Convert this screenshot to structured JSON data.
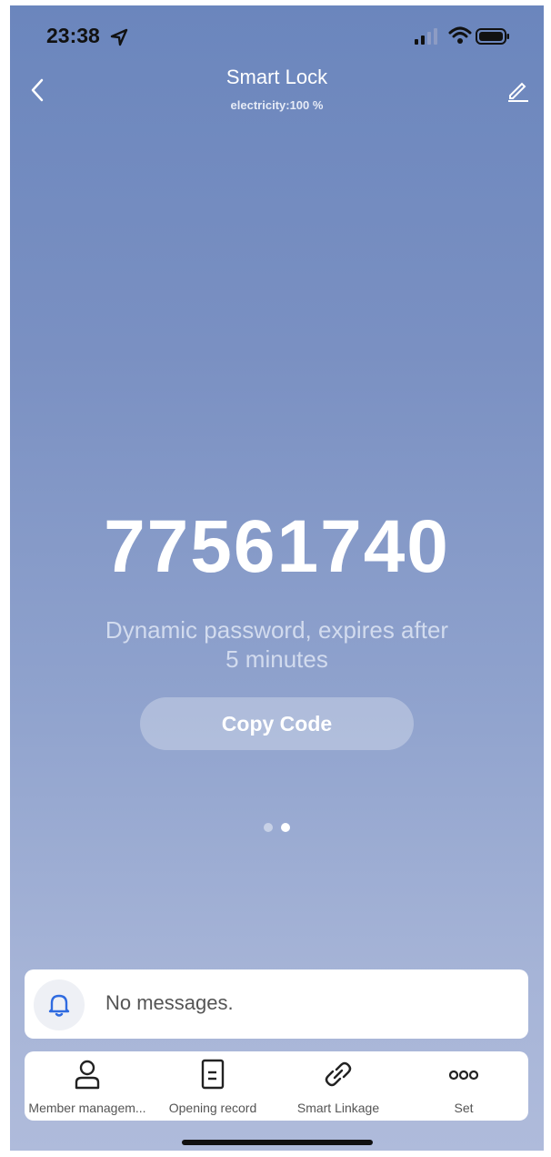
{
  "status_bar": {
    "time": "23:38"
  },
  "header": {
    "title": "Smart Lock",
    "subtitle": "electricity:100 %"
  },
  "password": {
    "code": "77561740",
    "description_line1": "Dynamic password, expires after",
    "description_line2": "5 minutes",
    "copy_label": "Copy Code"
  },
  "pager": {
    "count": 2,
    "active_index": 1
  },
  "messages": {
    "text": "No messages."
  },
  "tabs": [
    {
      "label": "Member managem...",
      "icon": "person-icon"
    },
    {
      "label": "Opening record",
      "icon": "document-icon"
    },
    {
      "label": "Smart Linkage",
      "icon": "link-icon"
    },
    {
      "label": "Set",
      "icon": "more-icon"
    }
  ],
  "colors": {
    "accent": "#2f6be0",
    "screen_top": "#6b86bd",
    "screen_bottom": "#afbbdb"
  }
}
